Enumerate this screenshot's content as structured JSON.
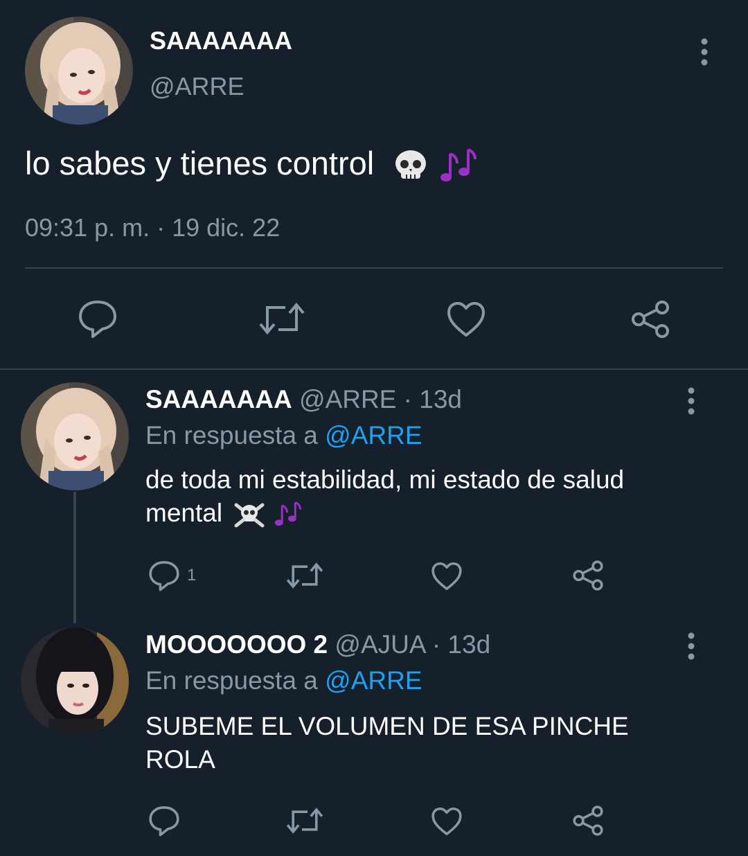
{
  "main_tweet": {
    "display_name": "SAAAAAAA",
    "handle": "@ARRE",
    "text": "lo sabes y tienes control",
    "emojis": [
      "skull-emoji",
      "musical-notes-emoji"
    ],
    "timestamp": "09:31 p. m. · 19 dic. 22",
    "actions": [
      "reply-icon",
      "retweet-icon",
      "like-icon",
      "share-icon"
    ]
  },
  "replies": [
    {
      "display_name": "SAAAAAAA",
      "handle": "@ARRE",
      "time": "· 13d",
      "replying_prefix": "En respuesta a",
      "replying_to": "@ARRE",
      "text_line1": "de toda mi estabilidad, mi estado de salud",
      "text_line2": "mental",
      "emojis": [
        "skull-crossbones-emoji",
        "musical-notes-emoji"
      ],
      "reply_count": "1"
    },
    {
      "display_name": "MOOOOOOO 2",
      "handle": "@AJUA",
      "time": "· 13d",
      "replying_prefix": "En respuesta a",
      "replying_to": "@ARRE",
      "text_line1": "SUBEME EL VOLUMEN DE ESA PINCHE",
      "text_line2": "ROLA",
      "reply_count": ""
    }
  ],
  "colors": {
    "background": "#15202b",
    "text": "#ffffff",
    "muted": "#8899a6",
    "link": "#1da1f2",
    "divider": "#38444d",
    "emoji_notes": "#9b2fc7"
  }
}
